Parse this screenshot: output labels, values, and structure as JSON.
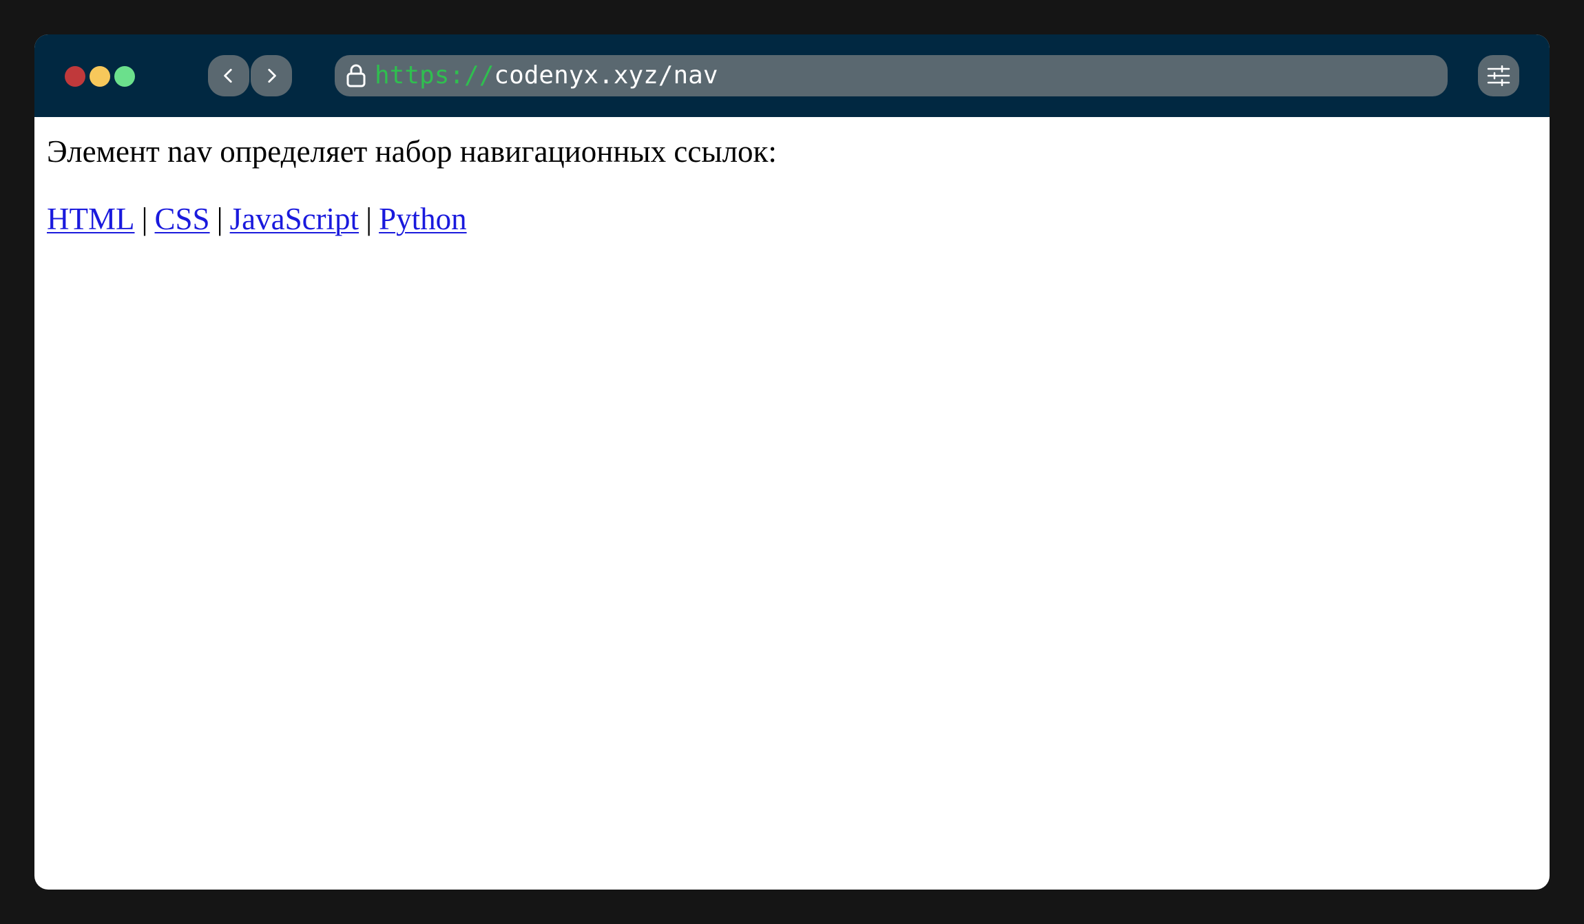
{
  "browser": {
    "traffic_lights": [
      {
        "name": "close",
        "color": "#c0393b"
      },
      {
        "name": "minimize",
        "color": "#f7c85b"
      },
      {
        "name": "maximize",
        "color": "#6be08c"
      }
    ],
    "back_icon": "chevron-left-icon",
    "forward_icon": "chevron-right-icon",
    "lock_icon": "lock-icon",
    "url_scheme": "https://",
    "url_rest": "codenyx.xyz/nav",
    "settings_icon": "sliders-icon",
    "titlebar_color": "#012841",
    "control_color": "#5a6870",
    "scheme_color": "#2fbf4f"
  },
  "page": {
    "intro_text": "Элемент nav определяет набор навигационных ссылок:",
    "separator": "|",
    "nav_links": [
      {
        "label": "HTML"
      },
      {
        "label": "CSS"
      },
      {
        "label": "JavaScript"
      },
      {
        "label": "Python"
      }
    ],
    "link_color": "#1a1add"
  }
}
